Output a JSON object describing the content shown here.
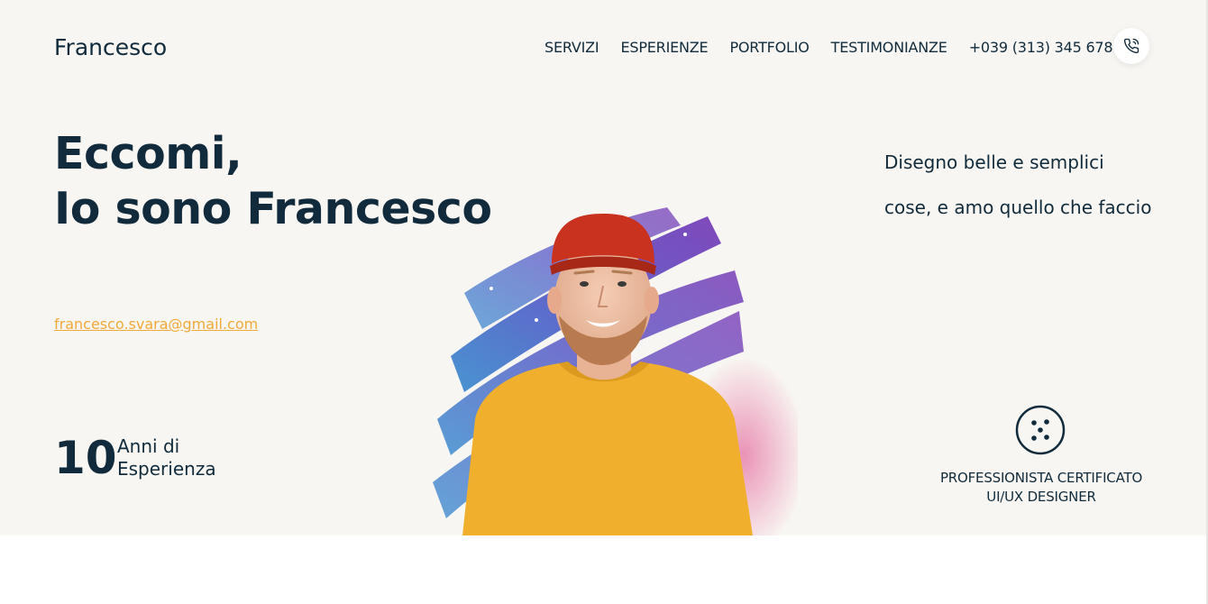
{
  "header": {
    "brand": "Francesco",
    "nav": [
      "SERVIZI",
      "ESPERIENZE",
      "PORTFOLIO",
      "TESTIMONIANZE",
      "+039 (313) 345 678"
    ],
    "phone_icon": "phone-icon"
  },
  "hero": {
    "headline_line1": "Eccomi,",
    "headline_line2": "Io sono Francesco",
    "email": "francesco.svara@gmail.com",
    "years_number": "10",
    "years_label_line1": "Anni di",
    "years_label_line2": "Esperienza",
    "tagline_line1": "Disegno belle e semplici",
    "tagline_line2": "cose, e amo quello che faccio",
    "badge_icon": "dice-icon",
    "badge_line1": "PROFESSIONISTA CERTIFICATO",
    "badge_line2": "UI/UX DESIGNER"
  },
  "colors": {
    "background": "#f8f6f2",
    "text": "#112b3c",
    "accent": "#f2a93b",
    "sweater": "#f0b02e",
    "beanie": "#c8321f",
    "brush_purple": "#6a4fc1",
    "brush_blue": "#3f8fd0",
    "brush_pink": "#e46a9e"
  }
}
